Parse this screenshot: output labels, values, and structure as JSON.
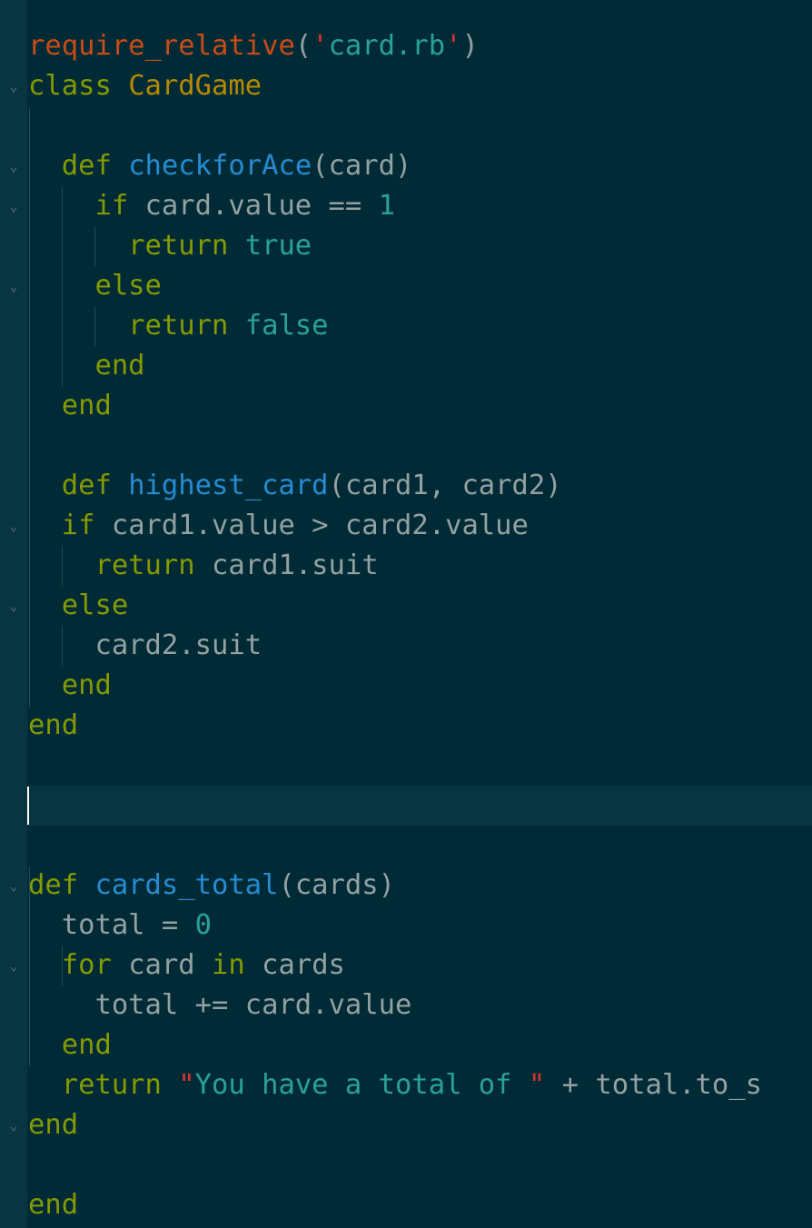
{
  "editor": {
    "caret_line": 20,
    "colors": {
      "background": "#002b36",
      "gutter": "#073642",
      "keyword": "#859900",
      "string": "#2aa198",
      "method_name": "#268bd2",
      "class_name": "#b58900",
      "require": "#cb4b16",
      "quote": "#dc322f"
    },
    "lines": [
      {
        "fold": false,
        "tokens": [
          [
            "require_relative",
            "fn-req"
          ],
          [
            "(",
            "paren"
          ],
          [
            "'",
            "quote"
          ],
          [
            "card.rb",
            "str"
          ],
          [
            "'",
            "quote"
          ],
          [
            ")",
            "paren"
          ]
        ]
      },
      {
        "fold": true,
        "tokens": [
          [
            "class ",
            "kw"
          ],
          [
            "CardGame",
            "class"
          ]
        ]
      },
      {
        "fold": false,
        "tokens": []
      },
      {
        "fold": true,
        "tokens": [
          [
            "  def ",
            "kw"
          ],
          [
            "checkforAce",
            "def"
          ],
          [
            "(card)",
            "plain"
          ]
        ]
      },
      {
        "fold": true,
        "tokens": [
          [
            "    if ",
            "kw"
          ],
          [
            "card.value == ",
            "plain"
          ],
          [
            "1",
            "const"
          ]
        ]
      },
      {
        "fold": false,
        "tokens": [
          [
            "      return ",
            "kw"
          ],
          [
            "true",
            "const"
          ]
        ]
      },
      {
        "fold": true,
        "tokens": [
          [
            "    else",
            "kw"
          ]
        ]
      },
      {
        "fold": false,
        "tokens": [
          [
            "      return ",
            "kw"
          ],
          [
            "false",
            "const"
          ]
        ]
      },
      {
        "fold": false,
        "tokens": [
          [
            "    end",
            "kw"
          ]
        ]
      },
      {
        "fold": false,
        "tokens": [
          [
            "  end",
            "kw"
          ]
        ]
      },
      {
        "fold": false,
        "tokens": []
      },
      {
        "fold": false,
        "tokens": [
          [
            "  def ",
            "kw"
          ],
          [
            "highest_card",
            "def"
          ],
          [
            "(card1, card2)",
            "plain"
          ]
        ]
      },
      {
        "fold": true,
        "tokens": [
          [
            "  if ",
            "kw"
          ],
          [
            "card1.value > card2.value",
            "plain"
          ]
        ]
      },
      {
        "fold": false,
        "tokens": [
          [
            "    return ",
            "kw"
          ],
          [
            "card1.suit",
            "plain"
          ]
        ]
      },
      {
        "fold": true,
        "tokens": [
          [
            "  else",
            "kw"
          ]
        ]
      },
      {
        "fold": false,
        "tokens": [
          [
            "    card2.suit",
            "plain"
          ]
        ]
      },
      {
        "fold": false,
        "tokens": [
          [
            "  end",
            "kw"
          ]
        ]
      },
      {
        "fold": false,
        "tokens": [
          [
            "end",
            "kw"
          ]
        ]
      },
      {
        "fold": false,
        "tokens": []
      },
      {
        "fold": false,
        "tokens": []
      },
      {
        "fold": false,
        "tokens": []
      },
      {
        "fold": true,
        "tokens": [
          [
            "def ",
            "kw"
          ],
          [
            "cards_total",
            "def"
          ],
          [
            "(cards)",
            "plain"
          ]
        ]
      },
      {
        "fold": false,
        "tokens": [
          [
            "  total = ",
            "plain"
          ],
          [
            "0",
            "const"
          ]
        ]
      },
      {
        "fold": true,
        "tokens": [
          [
            "  for ",
            "kw"
          ],
          [
            "card ",
            "plain"
          ],
          [
            "in ",
            "kw"
          ],
          [
            "cards",
            "plain"
          ]
        ]
      },
      {
        "fold": false,
        "tokens": [
          [
            "    total += card.value",
            "plain"
          ]
        ]
      },
      {
        "fold": false,
        "tokens": [
          [
            "  end",
            "kw"
          ]
        ]
      },
      {
        "fold": false,
        "tokens": [
          [
            "  return ",
            "kw"
          ],
          [
            "\"",
            "quote"
          ],
          [
            "You have a total of ",
            "str"
          ],
          [
            "\"",
            "quote"
          ],
          [
            " + total.to_s",
            "plain"
          ]
        ]
      },
      {
        "fold": true,
        "tokens": [
          [
            "end",
            "kw"
          ]
        ]
      },
      {
        "fold": false,
        "tokens": []
      },
      {
        "fold": false,
        "tokens": [
          [
            "end",
            "kw"
          ]
        ]
      }
    ]
  }
}
